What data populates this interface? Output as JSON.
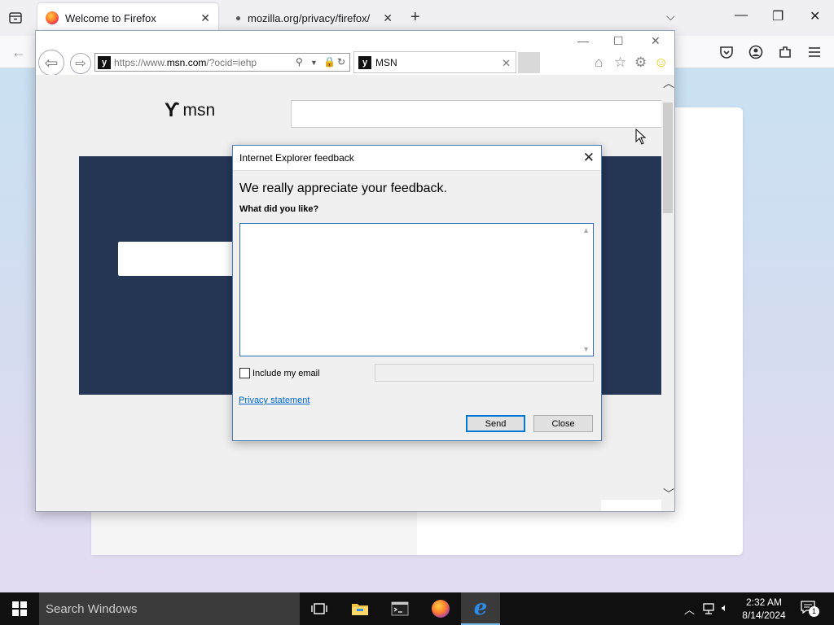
{
  "firefox": {
    "tabs": [
      {
        "label": "Welcome to Firefox"
      },
      {
        "label": "mozilla.org/privacy/firefox/"
      }
    ],
    "new_tab": "+"
  },
  "ie": {
    "address": {
      "prefix": "https://www.",
      "domain": "msn.com",
      "path": "/?ocid=iehp"
    },
    "tab": {
      "label": "MSN",
      "favicon": "y"
    },
    "msn_logo": "msn"
  },
  "dialog": {
    "title": "Internet Explorer feedback",
    "heading": "We really appreciate your feedback.",
    "question": "What did you like?",
    "textarea_value": "",
    "include_email_label": "Include my email",
    "include_email_checked": false,
    "email_value": "",
    "privacy_link": "Privacy statement",
    "send_label": "Send",
    "close_label": "Close"
  },
  "taskbar": {
    "search_placeholder": "Search Windows",
    "time": "2:32 AM",
    "date": "8/14/2024",
    "notification_count": "1"
  },
  "colors": {
    "msn_banner": "#263655",
    "dialog_border": "#4a7bb7",
    "link": "#0066cc",
    "taskbar": "#101010"
  }
}
